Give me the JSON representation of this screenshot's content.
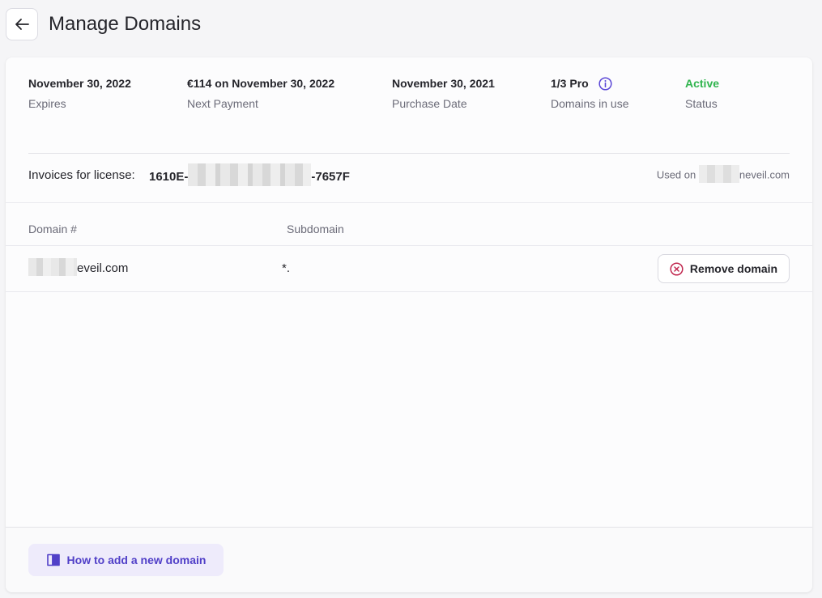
{
  "header": {
    "title": "Manage Domains"
  },
  "summary": {
    "expires_value": "November 30, 2022",
    "expires_label": "Expires",
    "next_payment_value": "€114 on November 30, 2022",
    "next_payment_label": "Next Payment",
    "purchase_value": "November 30, 2021",
    "purchase_label": "Purchase Date",
    "domains_value": "1/3 Pro",
    "domains_label": "Domains in use",
    "status_value": "Active",
    "status_label": "Status"
  },
  "invoice": {
    "label": "Invoices for license:",
    "key_start": "1610E-",
    "key_end": "-7657F",
    "used_on_label": "Used on",
    "used_on_domain_tail": "neveil.com"
  },
  "table": {
    "columns": [
      "Domain #",
      "Subdomain"
    ],
    "rows": [
      {
        "domain_tail": "eveil.com",
        "subdomain": "*."
      }
    ],
    "remove_label": "Remove domain"
  },
  "footer": {
    "howto_label": "How to add a new domain"
  },
  "colors": {
    "accent": "#5140c8",
    "active": "#2fb44d",
    "danger": "#c0264e",
    "info": "#5a46d6"
  },
  "icons": {
    "back": "arrow-left-icon",
    "info": "info-icon",
    "remove": "x-circle-icon",
    "book": "book-icon"
  }
}
